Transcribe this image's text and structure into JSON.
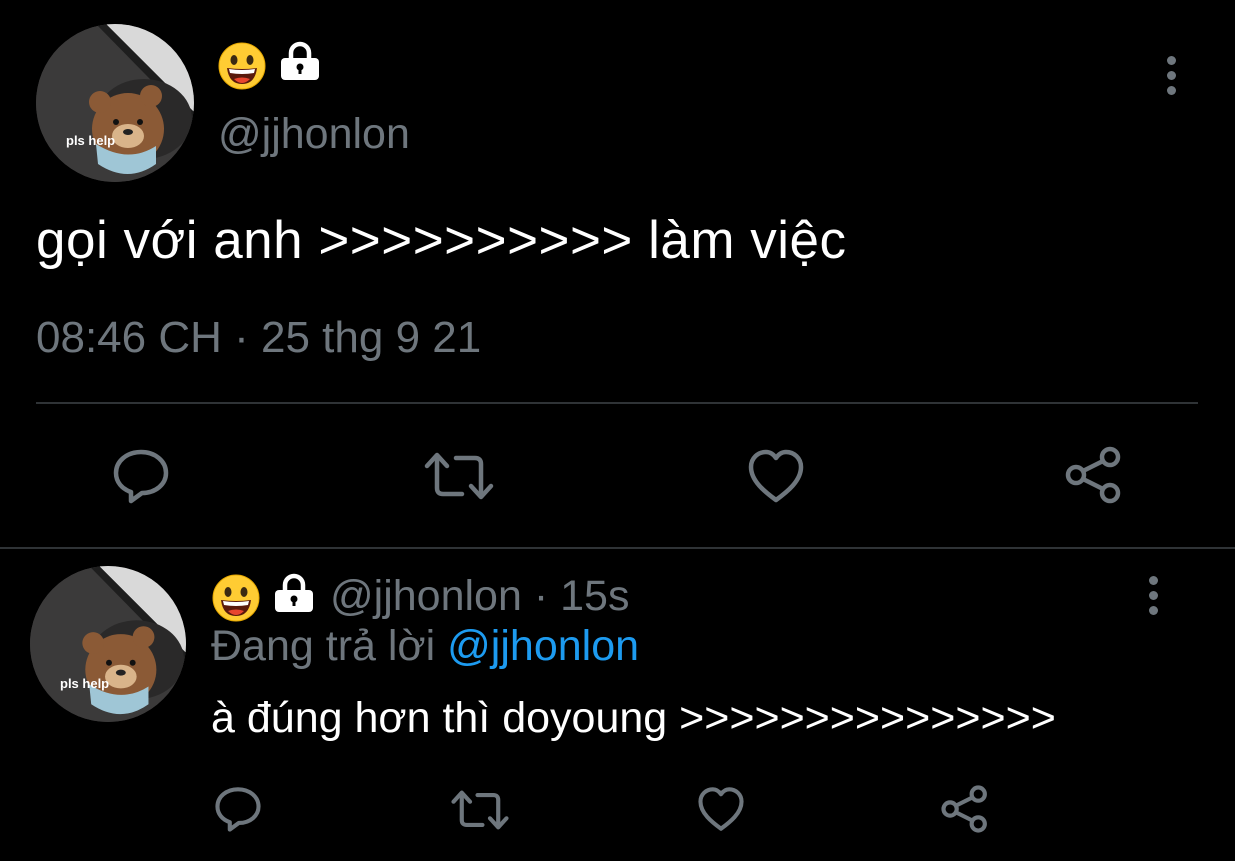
{
  "main_tweet": {
    "avatar_text": "pls help",
    "handle": "@jjhonlon",
    "text": "gọi với anh >>>>>>>>>> làm việc",
    "time": "08:46 CH",
    "separator": "·",
    "date": "25 thg 9 21"
  },
  "reply": {
    "avatar_text": "pls help",
    "handle": "@jjhonlon",
    "separator": "·",
    "age": "15s",
    "replying_prefix": "Đang trả lời",
    "replying_to": "@jjhonlon",
    "text": "à đúng hơn thì doyoung >>>>>>>>>>>>>>>"
  },
  "icons": {
    "emoji": "grinning-face-emoji",
    "lock": "lock-icon",
    "reply": "reply-icon",
    "retweet": "retweet-icon",
    "like": "heart-icon",
    "share": "share-icon",
    "more": "more-vertical-icon"
  },
  "colors": {
    "background": "#000000",
    "text": "#ffffff",
    "muted": "#6e767d",
    "link": "#1d9bf0",
    "divider": "#2f3336"
  }
}
